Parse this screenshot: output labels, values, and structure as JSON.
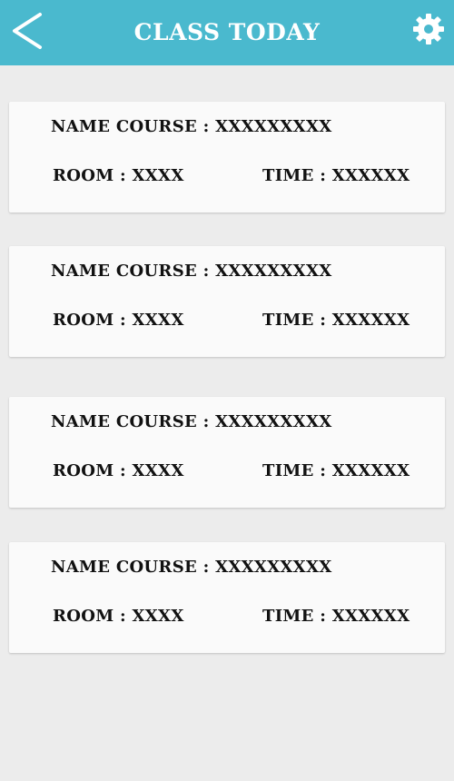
{
  "header": {
    "title": "CLASS TODAY",
    "back_icon": "chevron-left-icon",
    "settings_icon": "gear-icon",
    "background_color": "#4ab9ce"
  },
  "classes": [
    {
      "course": "NAME COURSE : XXXXXXXXX",
      "room": "ROOM : XXXX",
      "time": "TIME : XXXXXX"
    },
    {
      "course": "NAME COURSE : XXXXXXXXX",
      "room": "ROOM : XXXX",
      "time": "TIME : XXXXXX"
    },
    {
      "course": "NAME COURSE : XXXXXXXXX",
      "room": "ROOM : XXXX",
      "time": "TIME : XXXXXX"
    },
    {
      "course": "NAME COURSE : XXXXXXXXX",
      "room": "ROOM : XXXX",
      "time": "TIME : XXXXXX"
    }
  ]
}
